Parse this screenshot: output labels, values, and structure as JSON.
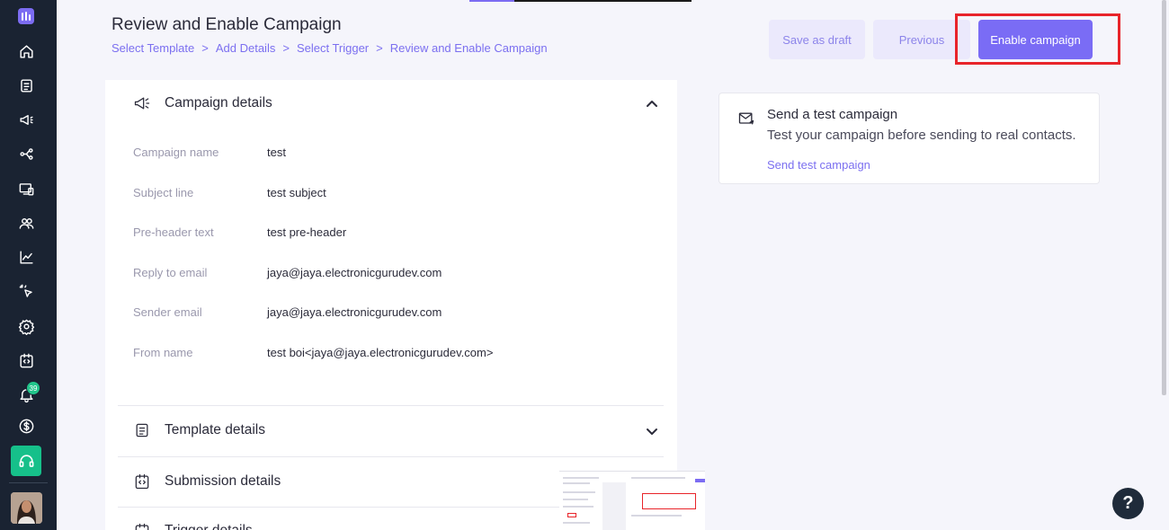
{
  "header": {
    "title": "Review and Enable Campaign",
    "breadcrumb": [
      "Select Template",
      "Add Details",
      "Select Trigger",
      "Review and Enable Campaign"
    ],
    "breadcrumb_separator": ">"
  },
  "actions": {
    "save_draft": "Save as draft",
    "previous": "Previous",
    "enable": "Enable campaign"
  },
  "sidebar": {
    "notification_count": "39",
    "icons": [
      "home-icon",
      "document-icon",
      "megaphone-icon",
      "workflow-icon",
      "device-icon",
      "contacts-icon",
      "analytics-icon",
      "cursor-click-icon",
      "settings-icon",
      "code-icon",
      "bell-icon",
      "dollar-icon",
      "headset-icon"
    ]
  },
  "campaign_details": {
    "title": "Campaign details",
    "fields": [
      {
        "label": "Campaign name",
        "value": "test"
      },
      {
        "label": "Subject line",
        "value": "test subject"
      },
      {
        "label": "Pre-header text",
        "value": "test pre-header"
      },
      {
        "label": "Reply to email",
        "value": "jaya@jaya.electronicgurudev.com"
      },
      {
        "label": "Sender email",
        "value": "jaya@jaya.electronicgurudev.com"
      },
      {
        "label": "From name",
        "value": "test boi<jaya@jaya.electronicgurudev.com>"
      }
    ]
  },
  "sections": {
    "template": "Template details",
    "submission": "Submission details",
    "trigger": "Trigger details"
  },
  "test_campaign": {
    "title": "Send a test campaign",
    "description": "Test your campaign before sending to real contacts.",
    "link": "Send test campaign"
  },
  "help": {
    "label": "?"
  },
  "colors": {
    "accent": "#7a6cf5",
    "sidebar": "#1a2332",
    "highlight": "#e8242a",
    "support": "#16c08a"
  }
}
